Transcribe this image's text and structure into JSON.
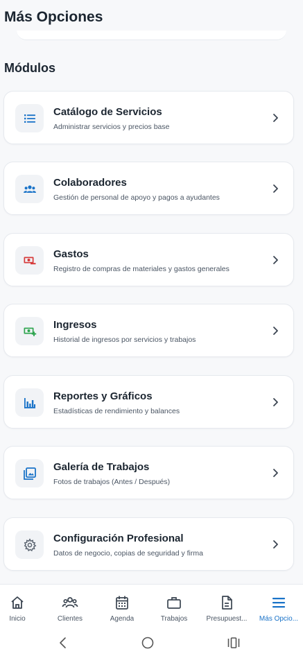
{
  "header": {
    "title": "Más Opciones"
  },
  "section": {
    "title": "Módulos"
  },
  "modules": [
    {
      "title": "Catálogo de Servicios",
      "subtitle": "Administrar servicios y precios base",
      "icon": "list-icon",
      "color": "#1a73c8"
    },
    {
      "title": "Colaboradores",
      "subtitle": "Gestión de personal de apoyo y pagos a ayudantes",
      "icon": "group-icon",
      "color": "#1a73c8"
    },
    {
      "title": "Gastos",
      "subtitle": "Registro de compras de materiales y gastos generales",
      "icon": "money-minus-icon",
      "color": "#d63a3a"
    },
    {
      "title": "Ingresos",
      "subtitle": "Historial de ingresos por servicios y trabajos",
      "icon": "money-plus-icon",
      "color": "#2ea44f"
    },
    {
      "title": "Reportes y Gráficos",
      "subtitle": "Estadísticas de rendimiento y balances",
      "icon": "bar-chart-icon",
      "color": "#1a73c8"
    },
    {
      "title": "Galería de Trabajos",
      "subtitle": "Fotos de trabajos (Antes / Después)",
      "icon": "gallery-icon",
      "color": "#1a73c8"
    },
    {
      "title": "Configuración Profesional",
      "subtitle": "Datos de negocio, copias de seguridad y firma",
      "icon": "gear-icon",
      "color": "#5b6470"
    }
  ],
  "tabs": [
    {
      "label": "Inicio",
      "icon": "home-icon",
      "active": false
    },
    {
      "label": "Clientes",
      "icon": "clients-icon",
      "active": false
    },
    {
      "label": "Agenda",
      "icon": "calendar-icon",
      "active": false
    },
    {
      "label": "Trabajos",
      "icon": "briefcase-icon",
      "active": false
    },
    {
      "label": "Presupuest...",
      "icon": "document-icon",
      "active": false
    },
    {
      "label": "Más Opcio...",
      "icon": "menu-icon",
      "active": true
    }
  ],
  "colors": {
    "accent": "#1a73c8",
    "text": "#1b2530",
    "muted": "#4a5563",
    "background": "#f7f8fa"
  }
}
